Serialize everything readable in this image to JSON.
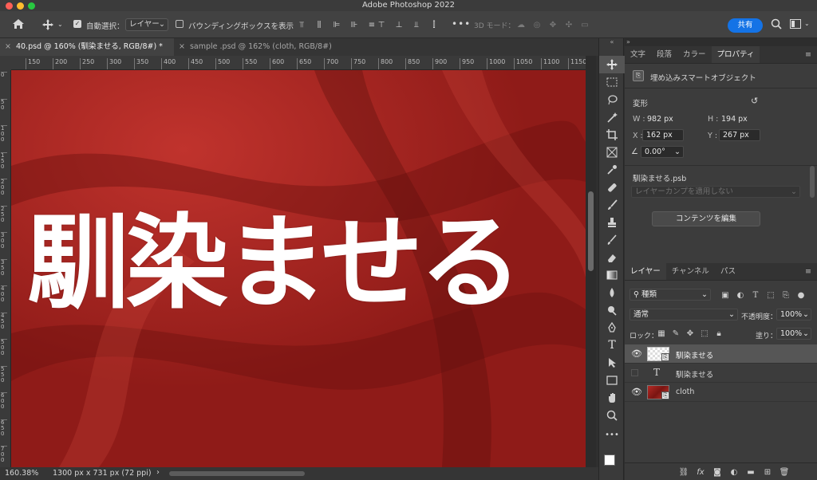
{
  "app": {
    "title": "Adobe Photoshop 2022"
  },
  "toolbar": {
    "auto_select_label": "自動選択：",
    "auto_select_value": "レイヤー",
    "bounding_box_label": "バウンディングボックスを表示",
    "three_d_label": "3D モード：",
    "share_label": "共有"
  },
  "tabs": [
    {
      "label": "40.psd @ 160% (馴染ませる, RGB/8#) *",
      "active": true
    },
    {
      "label": "sample .psd @ 162% (cloth, RGB/8#)",
      "active": false
    }
  ],
  "ruler_h": [
    "150",
    "200",
    "250",
    "300",
    "350",
    "400",
    "450",
    "500",
    "550",
    "600",
    "650",
    "700",
    "750",
    "800",
    "850",
    "900",
    "950",
    "1000",
    "1050",
    "1100",
    "1150"
  ],
  "ruler_v": [
    "0",
    "5 0",
    "1 0 0",
    "1 5 0",
    "2 0 0",
    "2 5 0",
    "3 0 0",
    "3 5 0",
    "4 0 0",
    "4 5 0",
    "5 0 0",
    "5 5 0",
    "6 0 0",
    "6 5 0",
    "7 0 0"
  ],
  "canvas": {
    "text": "馴染ませる",
    "fabric_color": "#a4231f",
    "text_color": "#ffffff"
  },
  "status": {
    "zoom": "160.38%",
    "doc_info": "1300 px x 731 px (72 ppi)"
  },
  "props_panel": {
    "tabs": [
      "文字",
      "段落",
      "カラー",
      "プロパティ"
    ],
    "object_type": "埋め込みスマートオブジェクト",
    "transform_label": "変形",
    "w_label": "W :",
    "w_value": "982 px",
    "h_label": "H :",
    "h_value": "194 px",
    "x_label": "X :",
    "x_value": "162 px",
    "y_label": "Y :",
    "y_value": "267 px",
    "angle_value": "0.00°",
    "filename": "馴染ませる.psb",
    "comp_placeholder": "レイヤーカンプを適用しない",
    "edit_contents": "コンテンツを編集"
  },
  "layers_panel": {
    "tabs": [
      "レイヤー",
      "チャンネル",
      "パス"
    ],
    "filter_label": "種類",
    "blend_mode": "通常",
    "opacity_label": "不透明度：",
    "opacity_value": "100%",
    "lock_label": "ロック：",
    "fill_label": "塗り：",
    "fill_value": "100%",
    "layers": [
      {
        "name": "馴染ませる",
        "type": "smart",
        "visible": true,
        "selected": true
      },
      {
        "name": "馴染ませる",
        "type": "text",
        "visible": false,
        "selected": false
      },
      {
        "name": "cloth",
        "type": "image",
        "visible": true,
        "selected": false
      }
    ]
  }
}
